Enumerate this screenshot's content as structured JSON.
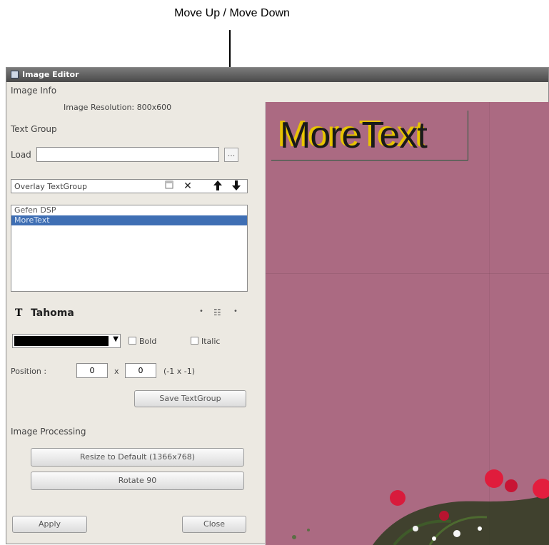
{
  "annotation": {
    "label": "Move Up / Move Down"
  },
  "window": {
    "title": "Image Editor"
  },
  "image_info": {
    "section_label": "Image Info",
    "resolution_text": "Image Resolution: 800x600"
  },
  "text_group": {
    "section_label": "Text Group",
    "load_label": "Load",
    "load_value": "",
    "browse_label": "...",
    "overlay_label": "Overlay TextGroup",
    "items": [
      "Gefen DSP",
      "MoreText"
    ],
    "selected_index": 1
  },
  "font": {
    "icon_glyph": "T",
    "name": "Tahoma",
    "size_glyph": "•",
    "options_glyph": "•",
    "color": "#000000",
    "bold_label": "Bold",
    "italic_label": "Italic"
  },
  "position": {
    "label": "Position :",
    "x": "0",
    "separator": "x",
    "y": "0",
    "hint": "(-1 x -1)"
  },
  "buttons": {
    "save_textgroup": "Save TextGroup",
    "resize_default": "Resize to Default (1366x768)",
    "rotate": "Rotate 90",
    "apply": "Apply",
    "close": "Close"
  },
  "image_processing": {
    "section_label": "Image Processing"
  },
  "preview": {
    "overlay_text": "MoreText",
    "background_color": "#ab6a82",
    "text_color": "#1a1a1a",
    "shadow_color": "#e8c400"
  }
}
